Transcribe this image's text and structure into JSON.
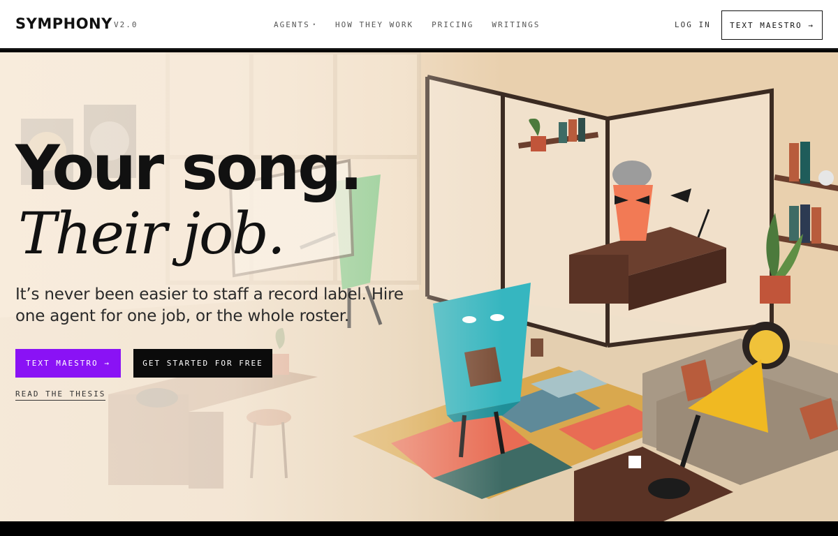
{
  "nav": {
    "brand": "SYMPHONY",
    "version": "V2.0",
    "links": [
      {
        "label": "AGENTS",
        "caret": "▾"
      },
      {
        "label": "HOW THEY WORK"
      },
      {
        "label": "PRICING"
      },
      {
        "label": "WRITINGS"
      }
    ],
    "login": "LOG IN",
    "cta": "TEXT MAESTRO →"
  },
  "hero": {
    "headline_line1": "Your song.",
    "headline_line2": "Their job.",
    "subtitle": "It’s never been easier to staff a record label. Hire one agent for one job, or the whole roster.",
    "primary_button": "TEXT MAESTRO →",
    "secondary_button": "GET STARTED FOR FREE",
    "link": "READ THE THESIS"
  },
  "colors": {
    "accent": "#8a12f5",
    "dark_button": "#0b0b0b",
    "background": "#f0e3d0"
  },
  "illustration": {
    "description_icons": [
      "office-scene-illustration",
      "green-agent-character",
      "teal-agent-character",
      "manager-character",
      "yellow-agent-character"
    ]
  }
}
